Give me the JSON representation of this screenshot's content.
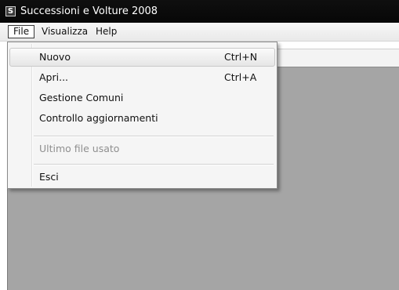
{
  "window": {
    "title": "Successioni e Volture 2008",
    "icon_letter": "S"
  },
  "menubar": {
    "items": [
      {
        "label": "File"
      },
      {
        "label": "Visualizza"
      },
      {
        "label": "Help"
      }
    ]
  },
  "file_menu": {
    "items": [
      {
        "label": "Nuovo",
        "shortcut": "Ctrl+N"
      },
      {
        "label": "Apri...",
        "shortcut": "Ctrl+A"
      },
      {
        "label": "Gestione Comuni",
        "shortcut": ""
      },
      {
        "label": "Controllo aggiornamenti",
        "shortcut": ""
      },
      {
        "label": "Ultimo file usato",
        "shortcut": ""
      },
      {
        "label": "Esci",
        "shortcut": ""
      }
    ]
  }
}
